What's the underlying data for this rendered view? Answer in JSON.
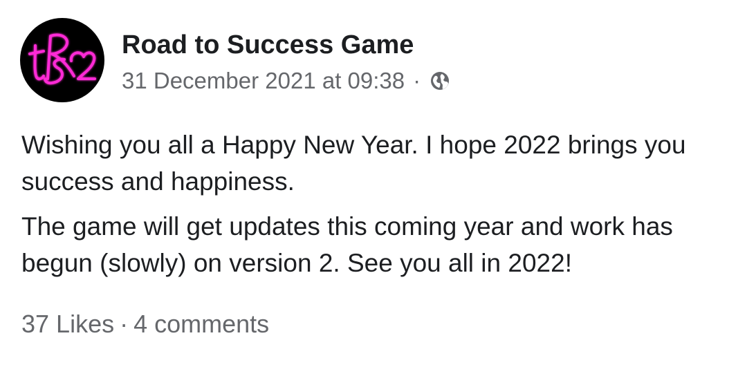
{
  "post": {
    "author": "Road to Success Game",
    "avatar_text": "tRS2",
    "avatar_colors": {
      "background": "#000000",
      "neon": "#ff2bd6"
    },
    "timestamp": "31 December 2021 at 09:38",
    "separator": "·",
    "privacy_icon": "globe-icon",
    "paragraphs": [
      "Wishing you all a Happy New Year. I hope 2022 brings you success and happiness.",
      "The game will get updates this coming year and work has begun (slowly) on version 2. See you all in 2022!"
    ],
    "likes": "37 Likes",
    "comments": "4 comments"
  },
  "colors": {
    "text_primary": "#1c1e21",
    "text_secondary": "#65676b"
  }
}
